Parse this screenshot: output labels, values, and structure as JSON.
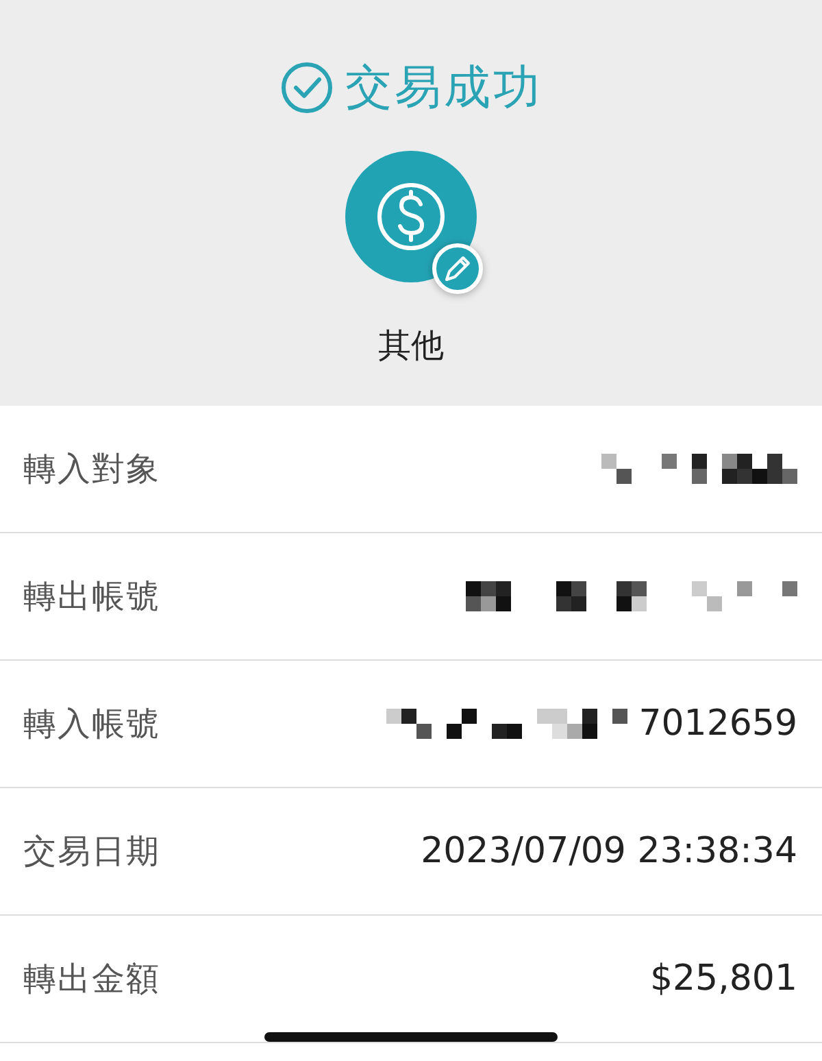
{
  "header": {
    "title": "交易成功",
    "category": "其他"
  },
  "rows": [
    {
      "label": "轉入對象",
      "redacted": true
    },
    {
      "label": "轉出帳號",
      "redacted": true
    },
    {
      "label": "轉入帳號",
      "redacted": true,
      "value": "7012659"
    },
    {
      "label": "交易日期",
      "redacted": false,
      "value": "2023/07/09 23:38:34"
    },
    {
      "label": "轉出金額",
      "redacted": false,
      "value": "$25,801"
    }
  ]
}
